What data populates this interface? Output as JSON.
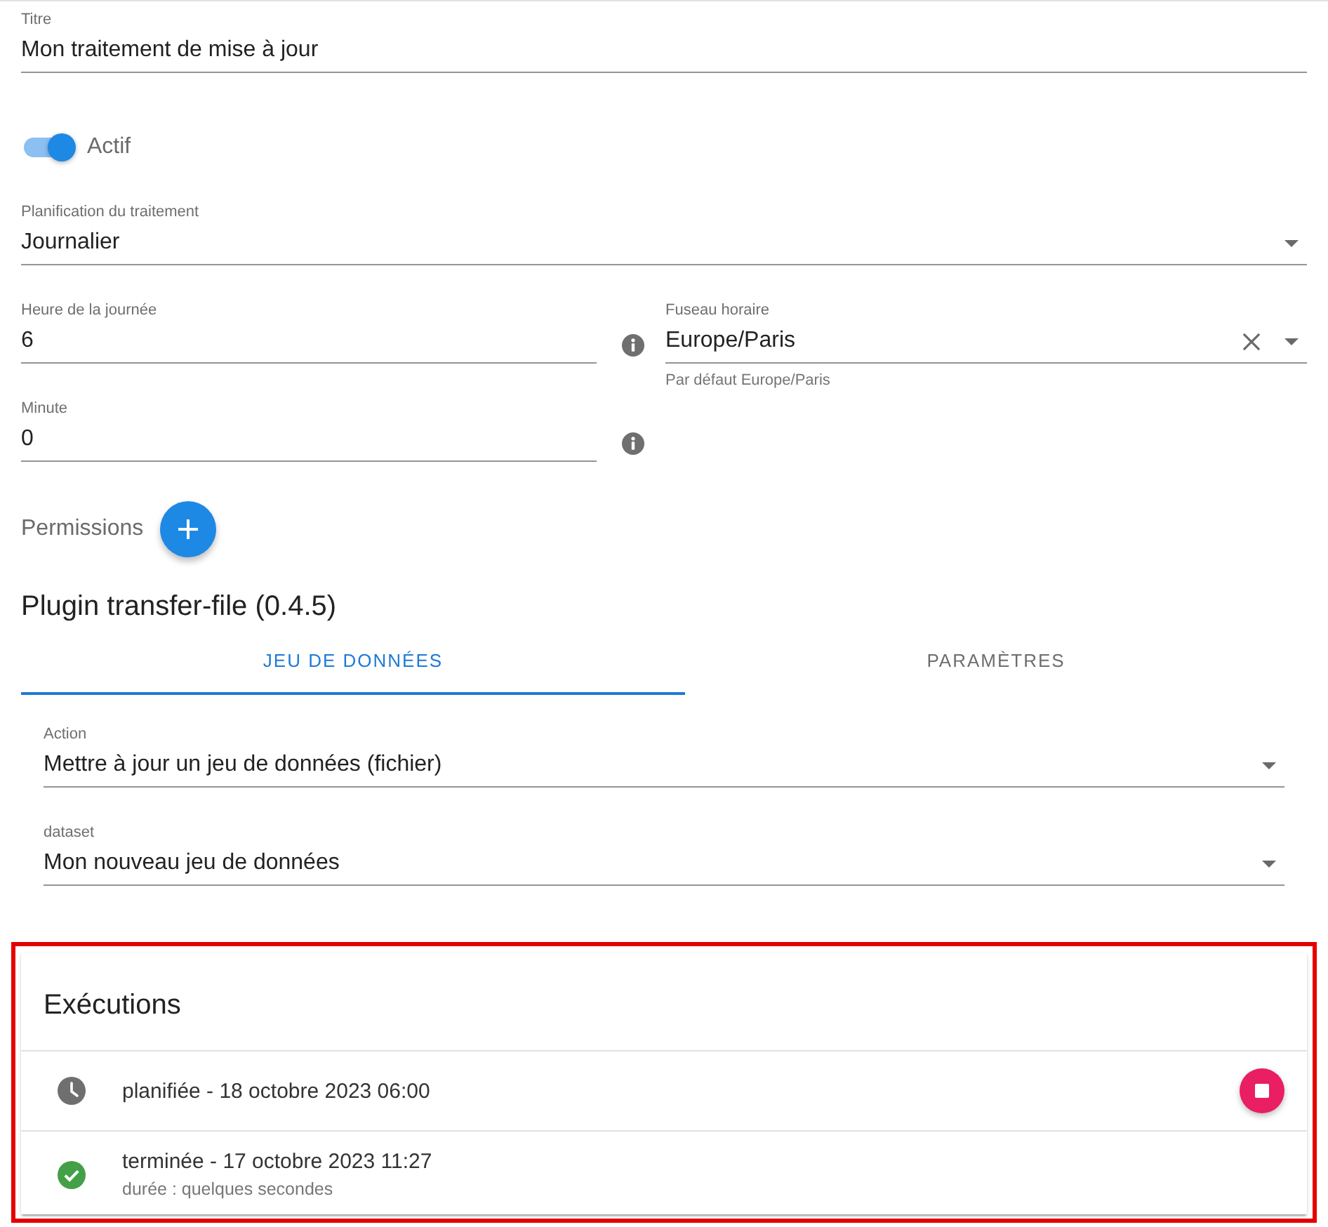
{
  "title_field": {
    "kind": "text",
    "label": "Titre",
    "value": "Mon traitement de mise à jour"
  },
  "active_switch": {
    "label": "Actif",
    "on": true
  },
  "schedule_field": {
    "kind": "select",
    "label": "Planification du traitement",
    "value": "Journalier"
  },
  "hour_field": {
    "kind": "text",
    "label": "Heure de la journée",
    "value": "6",
    "help": true
  },
  "timezone_field": {
    "kind": "select",
    "label": "Fuseau horaire",
    "value": "Europe/Paris",
    "clearable": true,
    "hint": "Par défaut Europe/Paris"
  },
  "minute_field": {
    "kind": "text",
    "label": "Minute",
    "value": "0",
    "help": true
  },
  "permissions": {
    "label": "Permissions"
  },
  "plugin": {
    "title": "Plugin transfer-file (0.4.5)",
    "tabs": [
      {
        "label": "JEU DE DONNÉES",
        "selected": true
      },
      {
        "label": "PARAMÈTRES",
        "selected": false
      }
    ],
    "fields": [
      {
        "kind": "select",
        "label": "Action",
        "value": "Mettre à jour un jeu de données (fichier)"
      },
      {
        "kind": "select",
        "label": "dataset",
        "value": "Mon nouveau jeu de données"
      }
    ]
  },
  "executions": {
    "title": "Exécutions",
    "highlighted": true,
    "items": [
      {
        "kind": "scheduled",
        "title": "planifiée - 18 octobre 2023 06:00"
      },
      {
        "kind": "finished",
        "title": "terminée - 17 octobre 2023 11:27",
        "subtitle": "durée : quelques secondes"
      }
    ]
  }
}
